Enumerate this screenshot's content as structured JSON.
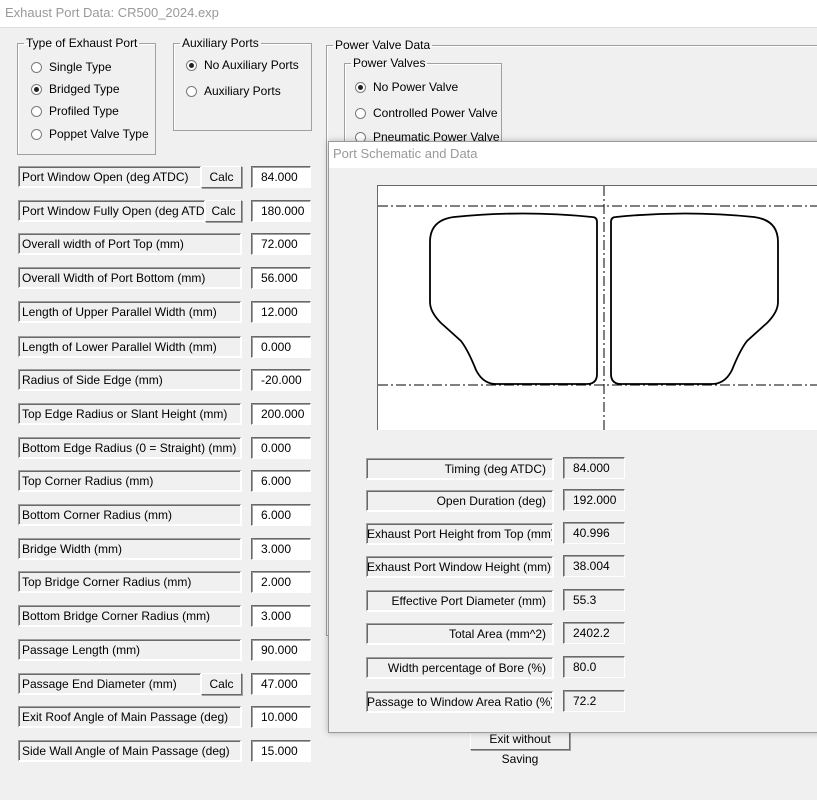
{
  "window": {
    "title": "Exhaust Port Data: CR500_2024.exp"
  },
  "type_group": {
    "legend": "Type of Exhaust Port",
    "options": [
      "Single Type",
      "Bridged Type",
      "Profiled Type",
      "Poppet Valve Type"
    ],
    "selected": "Bridged Type"
  },
  "aux_group": {
    "legend": "Auxiliary Ports",
    "options": [
      "No Auxiliary Ports",
      "Auxiliary Ports"
    ],
    "selected": "No Auxiliary Ports"
  },
  "power_valve": {
    "legend": "Power Valve Data",
    "inner_legend": "Power Valves",
    "options": [
      "No Power Valve",
      "Controlled Power Valve",
      "Pneumatic Power Valve"
    ],
    "selected": "No Power Valve"
  },
  "calc_label": "Calc",
  "fields": [
    {
      "label": "Port Window Open (deg ATDC)",
      "value": "84.000"
    },
    {
      "label": "Port Window Fully Open (deg ATDC)",
      "value": "180.000"
    },
    {
      "label": "Overall width of Port Top (mm)",
      "value": "72.000"
    },
    {
      "label": "Overall Width of Port Bottom (mm)",
      "value": "56.000"
    },
    {
      "label": "Length of Upper Parallel Width (mm)",
      "value": "12.000"
    },
    {
      "label": "Length of Lower Parallel Width (mm)",
      "value": "0.000"
    },
    {
      "label": "Radius of Side Edge (mm)",
      "value": "-20.000"
    },
    {
      "label": "Top Edge Radius or Slant Height (mm)",
      "value": "200.000"
    },
    {
      "label": "Bottom Edge Radius (0 = Straight) (mm)",
      "value": "0.000"
    },
    {
      "label": "Top Corner Radius (mm)",
      "value": "6.000"
    },
    {
      "label": "Bottom Corner Radius (mm)",
      "value": "6.000"
    },
    {
      "label": "Bridge Width (mm)",
      "value": "3.000"
    },
    {
      "label": "Top Bridge Corner Radius (mm)",
      "value": "2.000"
    },
    {
      "label": "Bottom Bridge Corner Radius (mm)",
      "value": "3.000"
    },
    {
      "label": "Passage Length (mm)",
      "value": "90.000"
    },
    {
      "label": "Passage End Diameter (mm)",
      "value": "47.000"
    },
    {
      "label": "Exit Roof Angle of Main Passage (deg)",
      "value": "10.000"
    },
    {
      "label": "Side Wall Angle of Main Passage (deg)",
      "value": "15.000"
    }
  ],
  "exit_button": "Exit without Saving",
  "schematic": {
    "title": "Port Schematic and Data",
    "results": [
      {
        "label": "Timing (deg ATDC)",
        "value": "84.000"
      },
      {
        "label": "Open Duration (deg)",
        "value": "192.000"
      },
      {
        "label": "Exhaust Port Height from Top (mm)",
        "value": "40.996"
      },
      {
        "label": "Exhaust Port Window Height (mm)",
        "value": "38.004"
      },
      {
        "label": "Effective Port Diameter (mm)",
        "value": "55.3"
      },
      {
        "label": "Total Area (mm^2)",
        "value": "2402.2"
      },
      {
        "label": "Width percentage of Bore (%)",
        "value": "80.0"
      },
      {
        "label": "Passage to Window Area Ratio (%)",
        "value": "72.2"
      }
    ]
  }
}
